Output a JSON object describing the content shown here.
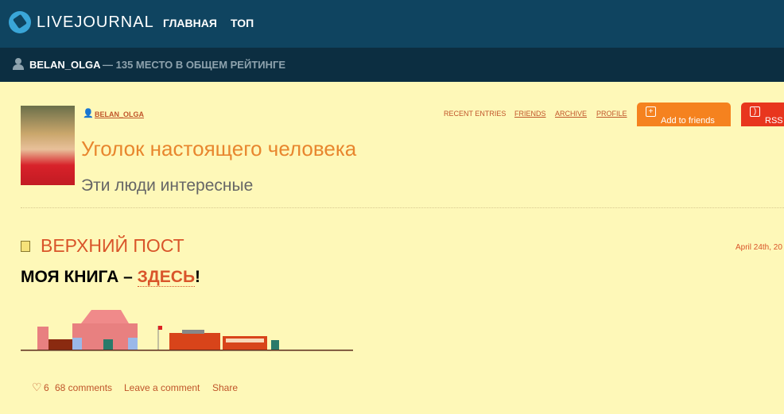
{
  "header": {
    "logo": "LIVEJOURNAL",
    "nav": [
      "ГЛАВНАЯ",
      "ТОП"
    ]
  },
  "subheader": {
    "username": "BELAN_OLGA",
    "rating": "— 135 МЕСТО В ОБЩЕМ РЕЙТИНГЕ"
  },
  "journal": {
    "username": "BELAN_OLGA",
    "title": "Уголок настоящего человека",
    "subtitle": "Эти люди интересные",
    "links": [
      "RECENT ENTRIES",
      "FRIENDS",
      "ARCHIVE",
      "PROFILE"
    ],
    "add_friends": "Add to friends",
    "rss": "RSS"
  },
  "post": {
    "title": "ВЕРХНИЙ ПОСТ",
    "date": "April 24th, 20",
    "book_text": "МОЯ КНИГА – ",
    "book_link": "ЗДЕСЬ",
    "book_end": "!",
    "likes": "6",
    "comments": "68 comments",
    "leave_comment": "Leave a comment",
    "share": "Share"
  },
  "colors": {
    "header": "#0f4460",
    "subheader": "#0c2e41",
    "background": "#fef8b8",
    "accent": "#d9552a",
    "add_button": "#f5821f",
    "rss_button": "#e8361e"
  }
}
